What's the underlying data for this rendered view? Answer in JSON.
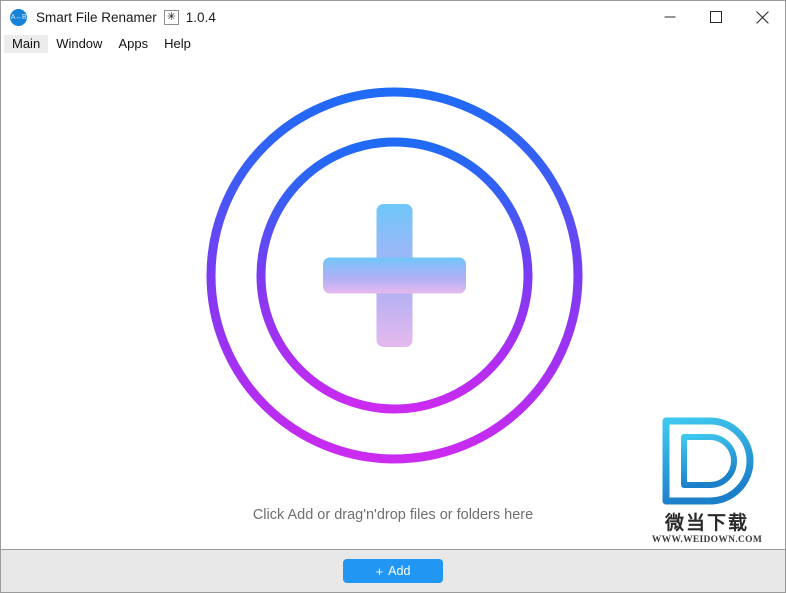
{
  "window": {
    "app_icon_name": "app-icon-ab",
    "app_icon_glyph": "A↔B",
    "title": "Smart File Renamer",
    "version_badge_glyph": "✳",
    "version": "1.0.4",
    "controls": {
      "minimize_label": "Minimize",
      "maximize_label": "Maximize",
      "close_label": "Close"
    }
  },
  "menu": {
    "items": [
      {
        "label": "Main",
        "active": true
      },
      {
        "label": "Window",
        "active": false
      },
      {
        "label": "Apps",
        "active": false
      },
      {
        "label": "Help",
        "active": false
      }
    ]
  },
  "drop_area": {
    "graphic_name": "add-circles-plus-icon",
    "hint_text": "Click Add or drag'n'drop files or folders here",
    "ring_gradient": {
      "top": "#1f6bf5",
      "middle": "#7b3bf2",
      "bottom": "#cc2bf0"
    },
    "plus_gradient": {
      "top": "#74c8f8",
      "middle": "#a9b1f5",
      "bottom": "#e2b9ee"
    }
  },
  "watermark": {
    "logo_name": "weidown-d-logo",
    "logo_color_top": "#35c0ea",
    "logo_color_bottom": "#1f86d0",
    "cn_text": "微当下载",
    "url_text": "WWW.WEIDOWN.COM"
  },
  "bottom_bar": {
    "add_button": {
      "plus_glyph": "+",
      "label": "Add",
      "color": "#2196f3"
    }
  }
}
